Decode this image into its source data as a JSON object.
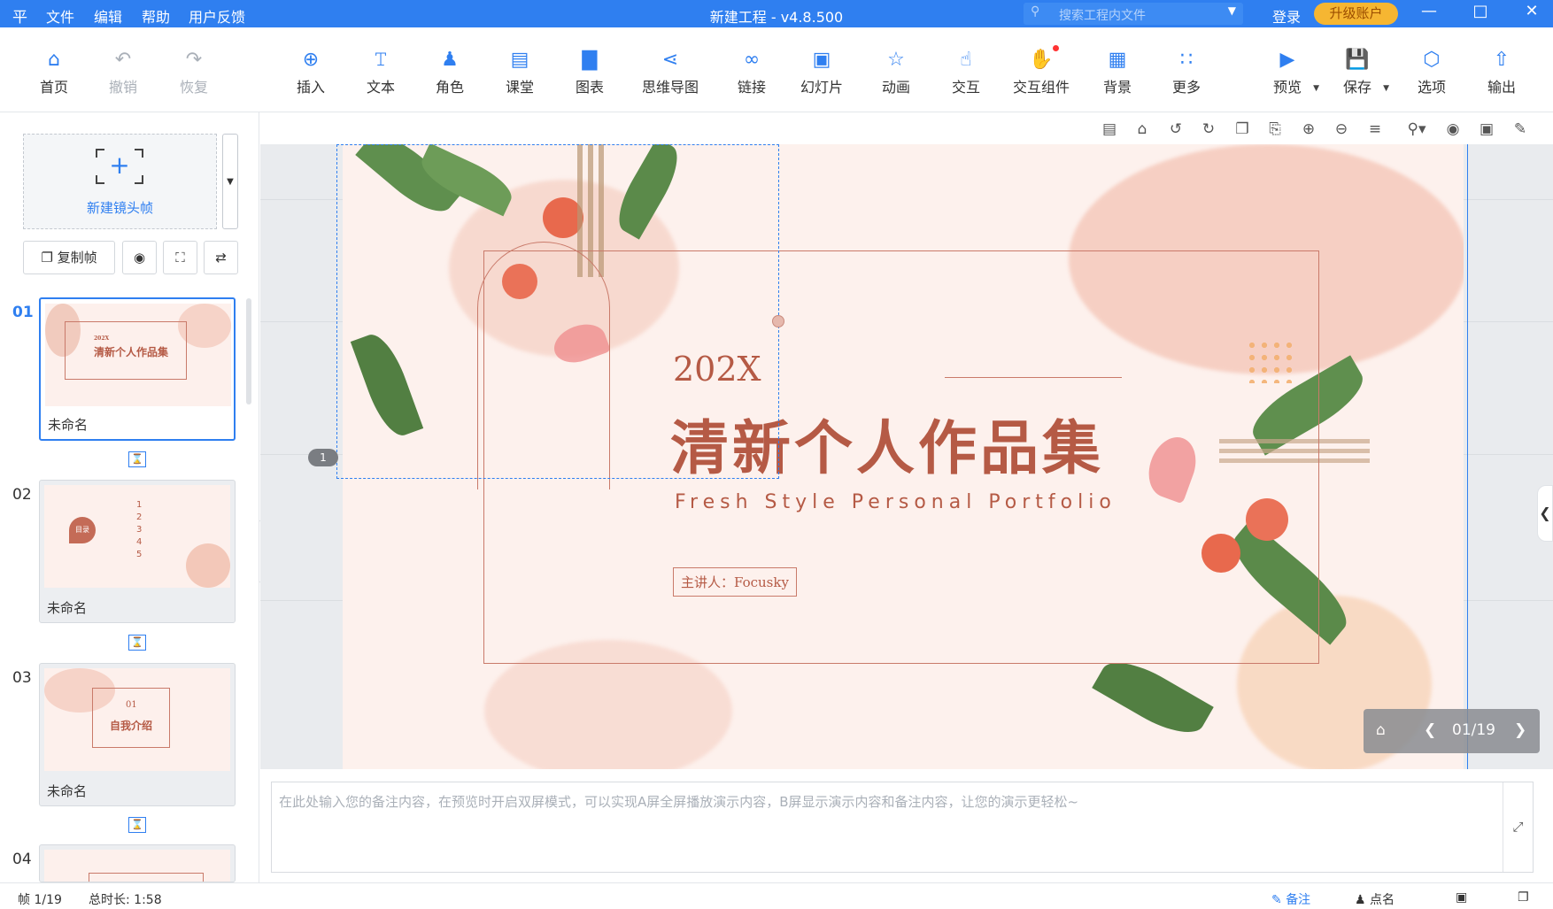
{
  "titlebar": {
    "logo": "平",
    "menu": [
      "文件",
      "编辑",
      "帮助",
      "用户反馈"
    ],
    "title": "新建工程 - v4.8.500",
    "search_placeholder": "搜索工程内文件",
    "login": "登录",
    "upgrade": "升级账户",
    "accent": "#2f7ff0"
  },
  "toolbar": {
    "home": "首页",
    "undo": "撤销",
    "redo": "恢复",
    "insert": "插入",
    "text": "文本",
    "role": "角色",
    "classroom": "课堂",
    "chart": "图表",
    "mindmap": "思维导图",
    "link": "链接",
    "slides": "幻灯片",
    "animation": "动画",
    "interaction": "交互",
    "widget": "交互组件",
    "background": "背景",
    "more": "更多",
    "preview": "预览",
    "save": "保存",
    "options": "选项",
    "export": "输出"
  },
  "left": {
    "new_frame": "新建镜头帧",
    "copy_frame": "复制帧",
    "frames": [
      {
        "num": "01",
        "name": "未命名",
        "year": "202X",
        "title": "清新个人作品集"
      },
      {
        "num": "02",
        "name": "未命名",
        "badge": "目录",
        "items": [
          "1",
          "2",
          "3",
          "4",
          "5"
        ]
      },
      {
        "num": "03",
        "name": "未命名",
        "num_label": "01",
        "title": "自我介绍"
      },
      {
        "num": "04",
        "name": ""
      }
    ]
  },
  "slide": {
    "year": "202X",
    "title": "清新个人作品集",
    "subtitle": "Fresh Style Personal Portfolio",
    "presenter": "主讲人：Focusky",
    "frame_tag": "1",
    "nav_counter": "01/19",
    "title_color": "#b55a45"
  },
  "notes": {
    "placeholder": "在此处输入您的备注内容，在预览时开启双屏模式，可以实现A屏全屏播放演示内容，B屏显示演示内容和备注内容，让您的演示更轻松~"
  },
  "status": {
    "frame": "帧 1/19",
    "duration": "总时长: 1:58",
    "notes": "备注",
    "rollcall": "点名"
  }
}
